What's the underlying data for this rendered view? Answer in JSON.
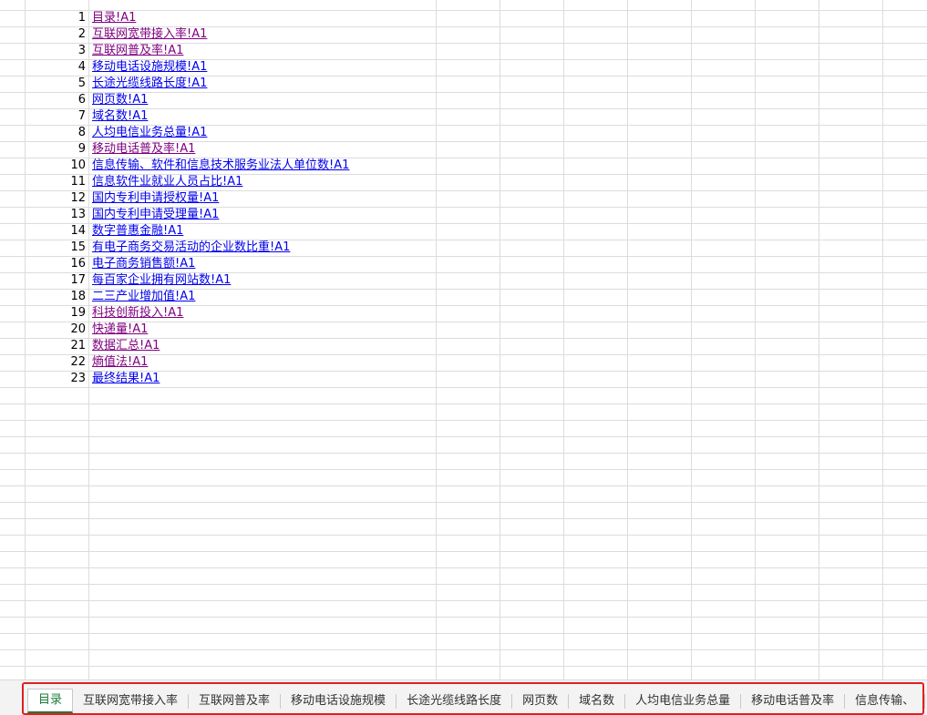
{
  "rows": [
    {
      "num": "1",
      "label": "目录!A1",
      "visited": true
    },
    {
      "num": "2",
      "label": "互联网宽带接入率!A1",
      "visited": true
    },
    {
      "num": "3",
      "label": "互联网普及率!A1",
      "visited": true
    },
    {
      "num": "4",
      "label": "移动电话设施规模!A1",
      "visited": false
    },
    {
      "num": "5",
      "label": "长途光缆线路长度!A1",
      "visited": false
    },
    {
      "num": "6",
      "label": "网页数!A1",
      "visited": false
    },
    {
      "num": "7",
      "label": "域名数!A1",
      "visited": false
    },
    {
      "num": "8",
      "label": "人均电信业务总量!A1",
      "visited": false
    },
    {
      "num": "9",
      "label": "移动电话普及率!A1",
      "visited": true
    },
    {
      "num": "10",
      "label": "信息传输、软件和信息技术服务业法人单位数!A1",
      "visited": false
    },
    {
      "num": "11",
      "label": "信息软件业就业人员占比!A1",
      "visited": false
    },
    {
      "num": "12",
      "label": "国内专利申请授权量!A1",
      "visited": false
    },
    {
      "num": "13",
      "label": "国内专利申请受理量!A1",
      "visited": false
    },
    {
      "num": "14",
      "label": "数字普惠金融!A1",
      "visited": false
    },
    {
      "num": "15",
      "label": "有电子商务交易活动的企业数比重!A1",
      "visited": false
    },
    {
      "num": "16",
      "label": "电子商务销售额!A1",
      "visited": false
    },
    {
      "num": "17",
      "label": "每百家企业拥有网站数!A1",
      "visited": false
    },
    {
      "num": "18",
      "label": "二三产业增加值!A1",
      "visited": false
    },
    {
      "num": "19",
      "label": "科技创新投入!A1",
      "visited": true
    },
    {
      "num": "20",
      "label": "快递量!A1",
      "visited": true
    },
    {
      "num": "21",
      "label": "数据汇总!A1",
      "visited": true
    },
    {
      "num": "22",
      "label": "熵值法!A1",
      "visited": true
    },
    {
      "num": "23",
      "label": "最终结果!A1",
      "visited": false
    }
  ],
  "tabs": [
    {
      "label": "目录",
      "active": true
    },
    {
      "label": "互联网宽带接入率",
      "active": false
    },
    {
      "label": "互联网普及率",
      "active": false
    },
    {
      "label": "移动电话设施规模",
      "active": false
    },
    {
      "label": "长途光缆线路长度",
      "active": false
    },
    {
      "label": "网页数",
      "active": false
    },
    {
      "label": "域名数",
      "active": false
    },
    {
      "label": "人均电信业务总量",
      "active": false
    },
    {
      "label": "移动电话普及率",
      "active": false
    },
    {
      "label": "信息传输、",
      "active": false
    }
  ],
  "colors": {
    "link": "#0000ee",
    "visited_link": "#800080",
    "active_tab": "#1e7a3a",
    "highlight": "#e02020"
  }
}
